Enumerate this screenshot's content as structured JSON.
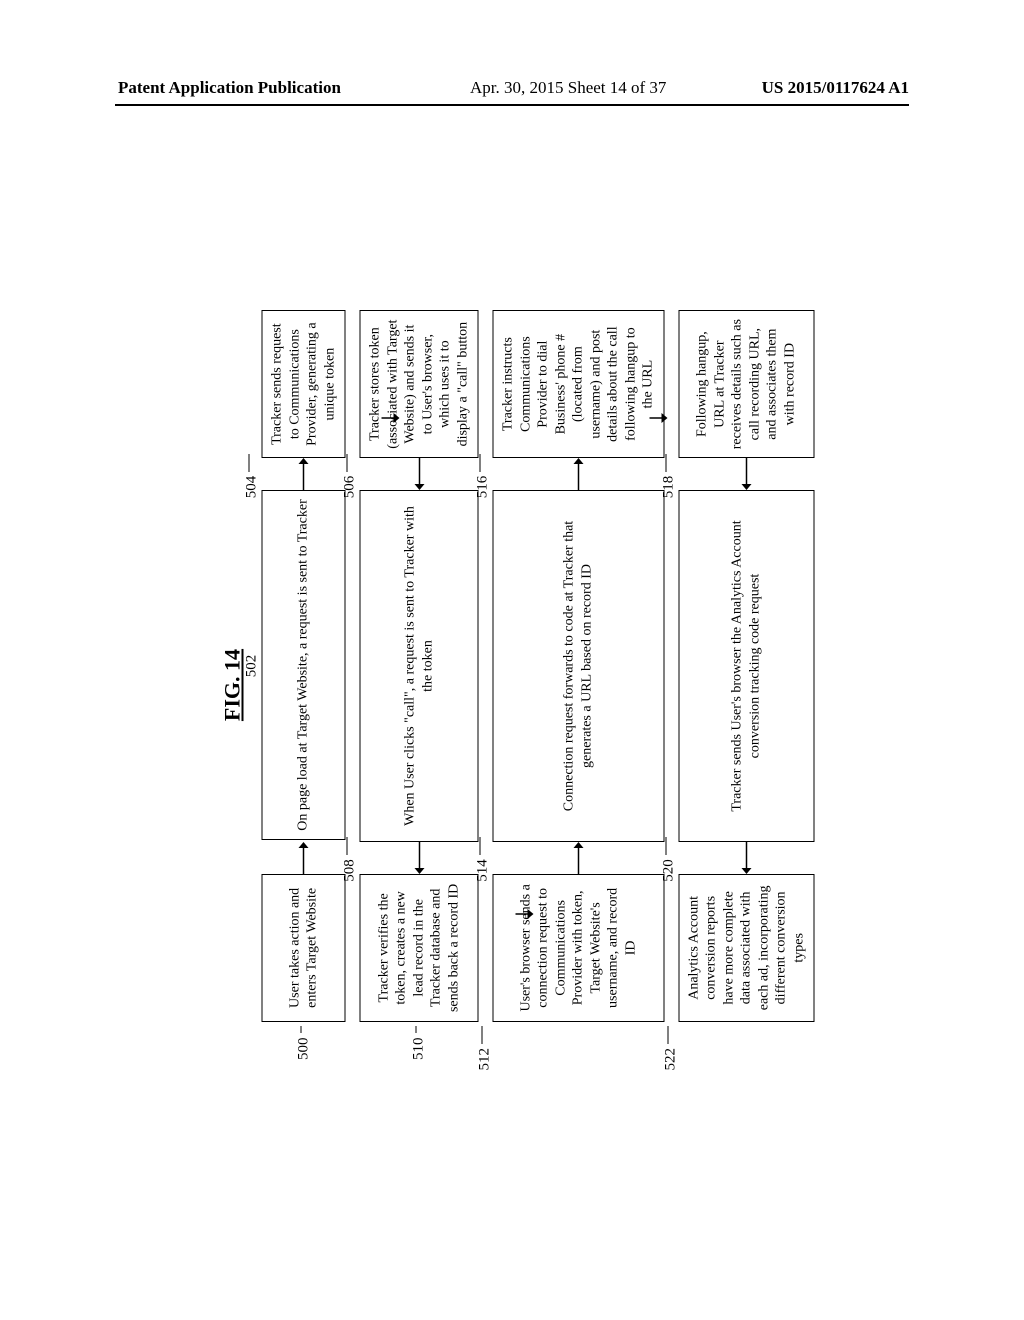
{
  "header": {
    "left": "Patent Application Publication",
    "mid": "Apr. 30, 2015  Sheet 14 of 37",
    "right": "US 2015/0117624 A1"
  },
  "figure": {
    "title": "FIG. 14",
    "labels": {
      "n500": "500",
      "n502": "502",
      "n504": "504",
      "n506": "506",
      "n508": "508",
      "n510": "510",
      "n512": "512",
      "n514": "514",
      "n516": "516",
      "n518": "518",
      "n520": "520",
      "n522": "522"
    },
    "boxes": {
      "b500": "User takes action and enters Target Website",
      "b502": "On page load at Target Website, a request is sent to Tracker",
      "b504": "Tracker sends request to Communications Provider, generating a unique token",
      "b506": "Tracker stores token (associated with Target Website) and sends it to User's browser, which uses it to display a \"call\" button",
      "b508": "When User clicks \"call\", a request is sent to Tracker with the token",
      "b510": "Tracker verifies the token, creates a new lead record in the Tracker database and sends back a record ID",
      "b512": "User's browser sends a connection request to Communications Provider with token, Target Website's username, and record ID",
      "b514": "Connection request forwards to code at Tracker that generates a URL based on record ID",
      "b516": "Tracker instructs Communications Provider to dial Business' phone # (located from username) and post details about the call following hangup to the URL",
      "b518": "Following hangup, URL at Tracker receives details such as call recording URL, and associates them with record ID",
      "b520": "Tracker sends User's browser the Analytics Account conversion tracking code request",
      "b522": "Analytics Account conversion reports have more complete data associated with each ad, incorporating different conversion types"
    }
  }
}
